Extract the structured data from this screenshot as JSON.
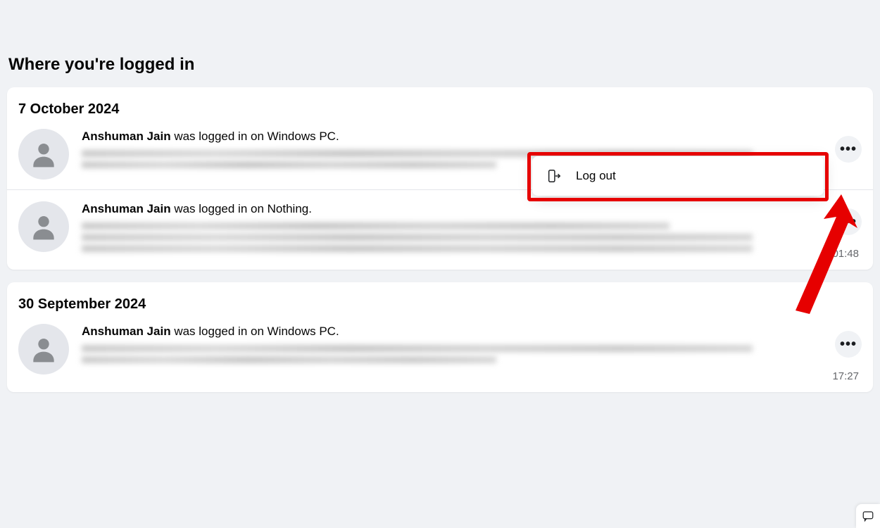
{
  "page_title": "Where you're logged in",
  "popover": {
    "logout_label": "Log out"
  },
  "groups": [
    {
      "date_label": "7 October 2024",
      "sessions": [
        {
          "user": "Anshuman Jain",
          "verb": " was logged in on ",
          "device": "Windows PC",
          "time": "",
          "blur_lines": [
            "long",
            "short"
          ]
        },
        {
          "user": "Anshuman Jain",
          "verb": " was logged in on ",
          "device": "Nothing",
          "time": "01:48",
          "blur_lines": [
            "med",
            "long",
            "long"
          ]
        }
      ]
    },
    {
      "date_label": "30 September 2024",
      "sessions": [
        {
          "user": "Anshuman Jain",
          "verb": " was logged in on ",
          "device": "Windows PC",
          "time": "17:27",
          "blur_lines": [
            "long",
            "short"
          ]
        }
      ]
    }
  ]
}
